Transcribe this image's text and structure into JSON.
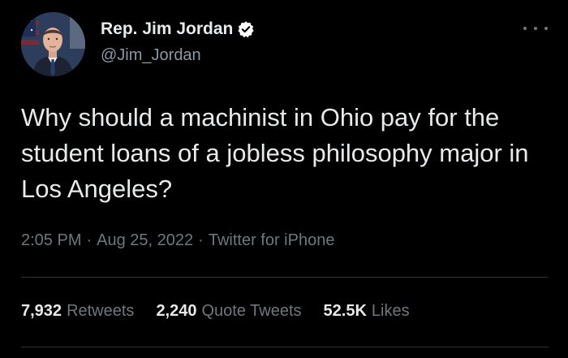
{
  "author": {
    "name": "Rep. Jim Jordan",
    "handle": "@Jim_Jordan",
    "verified_color": "#ffffff"
  },
  "tweet": {
    "text": "Why should a machinist in Ohio pay for the student loans of a jobless philosophy major in Los Angeles?",
    "time": "2:05 PM",
    "date": "Aug 25, 2022",
    "source": "Twitter for iPhone",
    "separator": "·"
  },
  "stats": {
    "retweets": {
      "count": "7,932",
      "label": "Retweets"
    },
    "quote_tweets": {
      "count": "2,240",
      "label": "Quote Tweets"
    },
    "likes": {
      "count": "52.5K",
      "label": "Likes"
    }
  },
  "colors": {
    "background": "#000000",
    "primary_text": "#e7e9ea",
    "secondary_text": "#71767b",
    "divider": "#2f3336"
  }
}
